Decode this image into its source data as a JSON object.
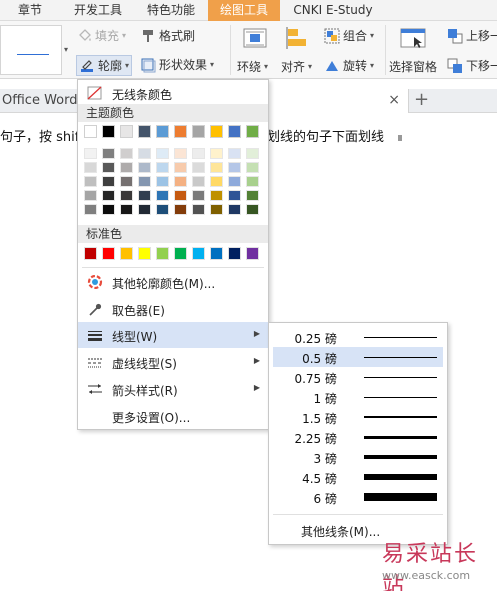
{
  "ribbon_tabs": [
    {
      "label": "章节",
      "active": false
    },
    {
      "label": "开发工具",
      "active": false
    },
    {
      "label": "特色功能",
      "active": false
    },
    {
      "label": "绘图工具",
      "active": true
    },
    {
      "label": "CNKI E-Study",
      "active": false
    }
  ],
  "ribbon": {
    "fill_label": "填充",
    "format_painter_label": "格式刷",
    "outline_label": "轮廓",
    "shape_effect_label": "形状效果",
    "wrap_label": "环绕",
    "align_label": "对齐",
    "group_label": "组合",
    "rotate_label": "旋转",
    "selection_pane_label": "选择窗格",
    "bring_forward_label": "上移一",
    "send_backward_label": "下移一"
  },
  "document_tabs": {
    "left_tab_label": "Office Word 2",
    "close_symbol": "×",
    "add_symbol": "+"
  },
  "document": {
    "text_left": "句子，按 shift",
    "text_right": "划线的句子下面划线"
  },
  "outline_menu": {
    "no_line_label": "无线条颜色",
    "theme_colors_header": "主题颜色",
    "standard_colors_header": "标准色",
    "more_colors_label": "其他轮廓颜色(M)...",
    "eyedropper_label": "取色器(E)",
    "line_style_label": "线型(W)",
    "dash_style_label": "虚线线型(S)",
    "arrow_style_label": "箭头样式(R)",
    "more_settings_label": "更多设置(O)...",
    "theme_top_row": [
      "#ffffff",
      "#000000",
      "#e7e6e6",
      "#44546a",
      "#5b9bd5",
      "#ed7d31",
      "#a5a5a5",
      "#ffc000",
      "#4472c4",
      "#70ad47"
    ],
    "theme_shades": [
      [
        "#f2f2f2",
        "#7f7f7f",
        "#d0cece",
        "#d6dce4",
        "#deebf6",
        "#fbe5d5",
        "#ededed",
        "#fff2cc",
        "#d9e2f3",
        "#e2efd9"
      ],
      [
        "#d8d8d8",
        "#595959",
        "#aeabab",
        "#adb9ca",
        "#bdd7ee",
        "#f7cbac",
        "#dbdbdb",
        "#fee599",
        "#b4c6e7",
        "#c5e0b3"
      ],
      [
        "#bfbfbf",
        "#3f3f3f",
        "#757070",
        "#8496b0",
        "#9cc3e5",
        "#f4b183",
        "#c9c9c9",
        "#ffd965",
        "#8eaadb",
        "#a8d08d"
      ],
      [
        "#a5a5a5",
        "#262626",
        "#3a3838",
        "#323f4f",
        "#2e75b5",
        "#c55a11",
        "#7b7b7b",
        "#bf9000",
        "#2f5496",
        "#538135"
      ],
      [
        "#7f7f7f",
        "#0c0c0c",
        "#171616",
        "#222a35",
        "#1e4e79",
        "#833c0b",
        "#525252",
        "#7f6000",
        "#1f3864",
        "#375623"
      ]
    ],
    "standard_colors": [
      "#c00000",
      "#ff0000",
      "#ffc000",
      "#ffff00",
      "#92d050",
      "#00b050",
      "#00b0f0",
      "#0070c0",
      "#002060",
      "#7030a0"
    ],
    "outline_accent": "#2f6fd6"
  },
  "line_weights": [
    {
      "label": "0.25 磅",
      "pt": 0.25,
      "selected": false
    },
    {
      "label": "0.5 磅",
      "pt": 0.5,
      "selected": true
    },
    {
      "label": "0.75 磅",
      "pt": 0.75,
      "selected": false
    },
    {
      "label": "1 磅",
      "pt": 1,
      "selected": false
    },
    {
      "label": "1.5 磅",
      "pt": 1.5,
      "selected": false
    },
    {
      "label": "2.25 磅",
      "pt": 2.25,
      "selected": false
    },
    {
      "label": "3 磅",
      "pt": 3,
      "selected": false
    },
    {
      "label": "4.5 磅",
      "pt": 4.5,
      "selected": false
    },
    {
      "label": "6 磅",
      "pt": 6,
      "selected": false
    }
  ],
  "line_menu": {
    "more_lines_label": "其他线条(M)..."
  },
  "watermark": {
    "title": "易采站长站",
    "url": "www.easck.com"
  }
}
